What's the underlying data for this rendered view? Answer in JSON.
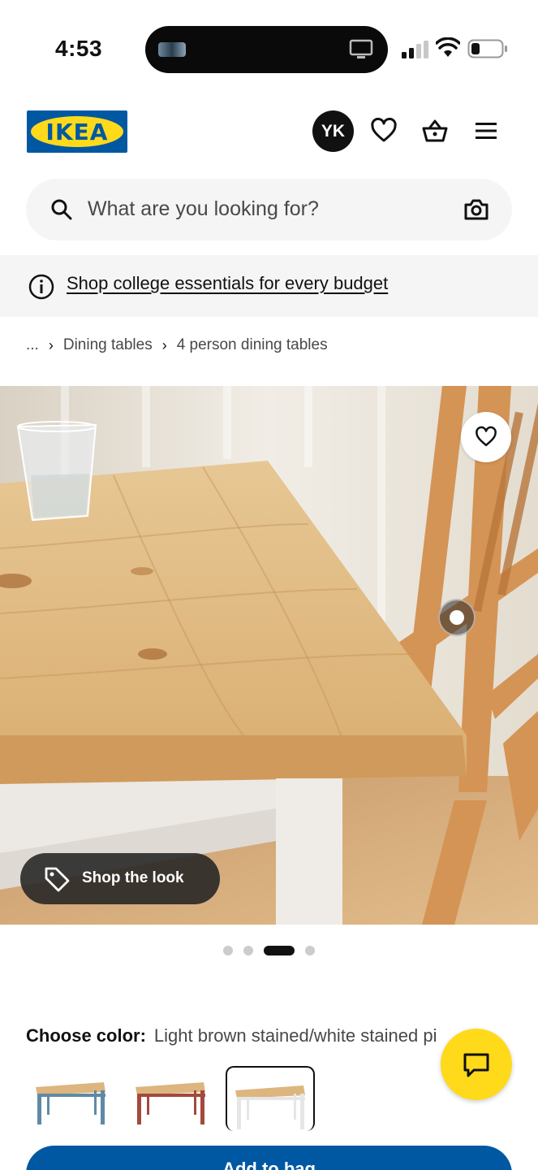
{
  "status_bar": {
    "time": "4:53",
    "icons": [
      "signal-icon",
      "wifi-icon",
      "battery-icon"
    ]
  },
  "header": {
    "logo_text": "IKEA",
    "avatar_initials": "YK",
    "icons": [
      "heart-icon",
      "basket-icon",
      "menu-icon"
    ]
  },
  "search": {
    "placeholder": "What are you looking for?"
  },
  "banner": {
    "link_text": "Shop college essentials for every budget"
  },
  "breadcrumb": {
    "ellipsis": "...",
    "items": [
      "Dining tables",
      "4 person dining tables"
    ]
  },
  "gallery": {
    "shop_the_look_label": "Shop the look",
    "slide_count": 4,
    "active_slide": 3
  },
  "color_chooser": {
    "label": "Choose color:",
    "selected_value": "Light brown stained/white stained pi",
    "options": [
      {
        "name": "blue",
        "leg_color": "#5f8aa6"
      },
      {
        "name": "red",
        "leg_color": "#a4493d"
      },
      {
        "name": "white",
        "leg_color": "#e6e6e6"
      }
    ],
    "selected_index": 2
  },
  "actions": {
    "add_to_bag_label": "Add to bag"
  },
  "colors": {
    "brand_blue": "#0058a3",
    "brand_yellow": "#ffda1a"
  }
}
